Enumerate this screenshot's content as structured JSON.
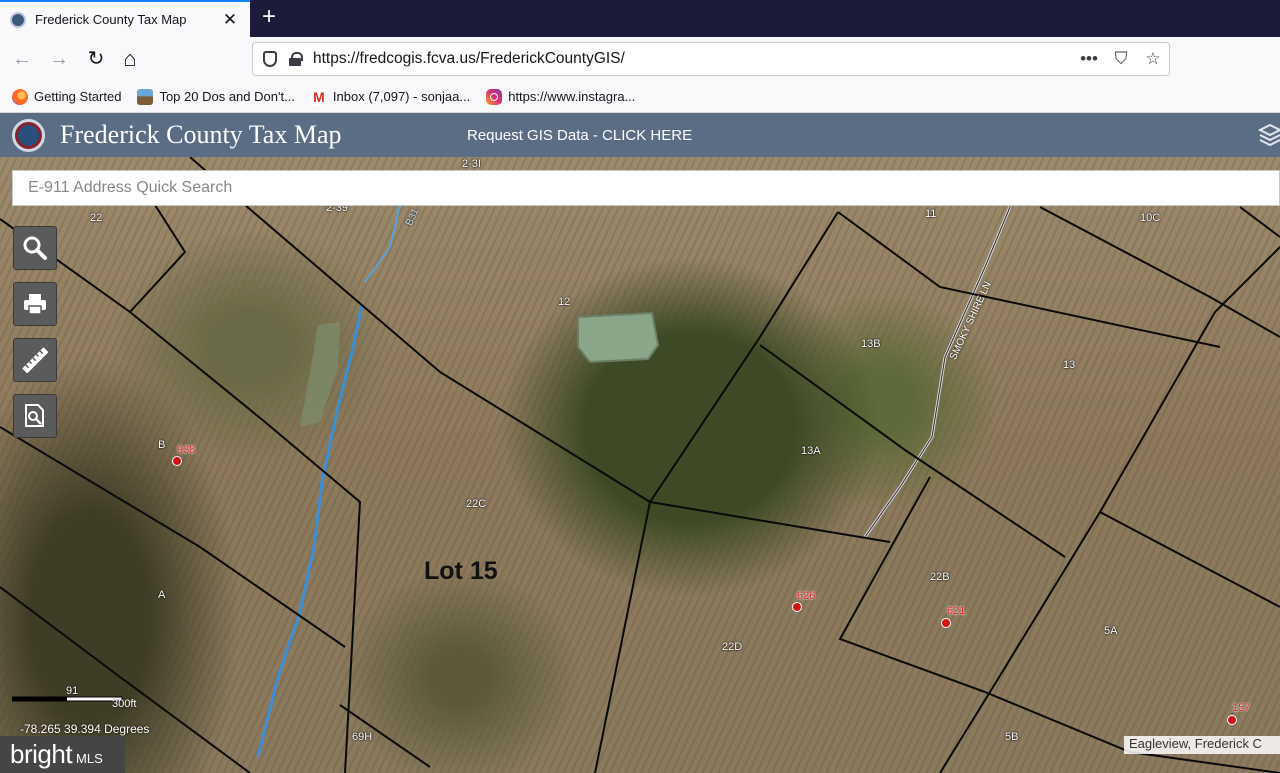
{
  "browser": {
    "tab_title": "Frederick County Tax Map",
    "tab_close": "✕",
    "new_tab": "+",
    "url": "https://fredcogis.fcva.us/FrederickCountyGIS/",
    "url_actions": {
      "more": "•••",
      "pocket": "⛉",
      "star": "☆"
    },
    "nav": {
      "back": "←",
      "forward": "→",
      "reload": "↻",
      "home": "⌂"
    },
    "bookmarks": [
      {
        "label": "Getting Started",
        "icon": "firefox-icon"
      },
      {
        "label": "Top 20 Dos and Don't...",
        "icon": "thumbnail-icon"
      },
      {
        "label": "Inbox (7,097) - sonjaa...",
        "icon": "gmail-icon",
        "glyph": "M"
      },
      {
        "label": "https://www.instagra...",
        "icon": "instagram-icon"
      }
    ]
  },
  "app": {
    "title": "Frederick County Tax Map",
    "gis_link": "Request GIS Data - CLICK HERE",
    "search_placeholder": "E-911 Address Quick Search"
  },
  "tools": [
    {
      "name": "search-tool-button",
      "icon": "magnifier-icon"
    },
    {
      "name": "print-tool-button",
      "icon": "printer-icon"
    },
    {
      "name": "measure-tool-button",
      "icon": "ruler-icon"
    },
    {
      "name": "identify-tool-button",
      "icon": "zoom-document-icon"
    }
  ],
  "map": {
    "parcel_labels": [
      "22",
      "2-39",
      "2-3I",
      "12",
      "11",
      "10C",
      "13B",
      "13",
      "B",
      "13A",
      "22C",
      "A",
      "22B",
      "5A",
      "22D",
      "69H",
      "5B"
    ],
    "address_points": [
      "938",
      "626",
      "621",
      "157"
    ],
    "road_labels": [
      "SMOKY SHIRE LN",
      "B31"
    ],
    "lot_label": "Lot 15",
    "scale_number": "91",
    "scale_unit": "300ft",
    "coordinates": "-78.265 39.394 Degrees",
    "attribution": "Eagleview, Frederick C",
    "colors": {
      "parcel_line": "#0a0a0a",
      "stream": "#3b8fd6",
      "address": "#cc1414"
    }
  },
  "watermark": {
    "brand": "bright",
    "suffix": "MLS"
  }
}
